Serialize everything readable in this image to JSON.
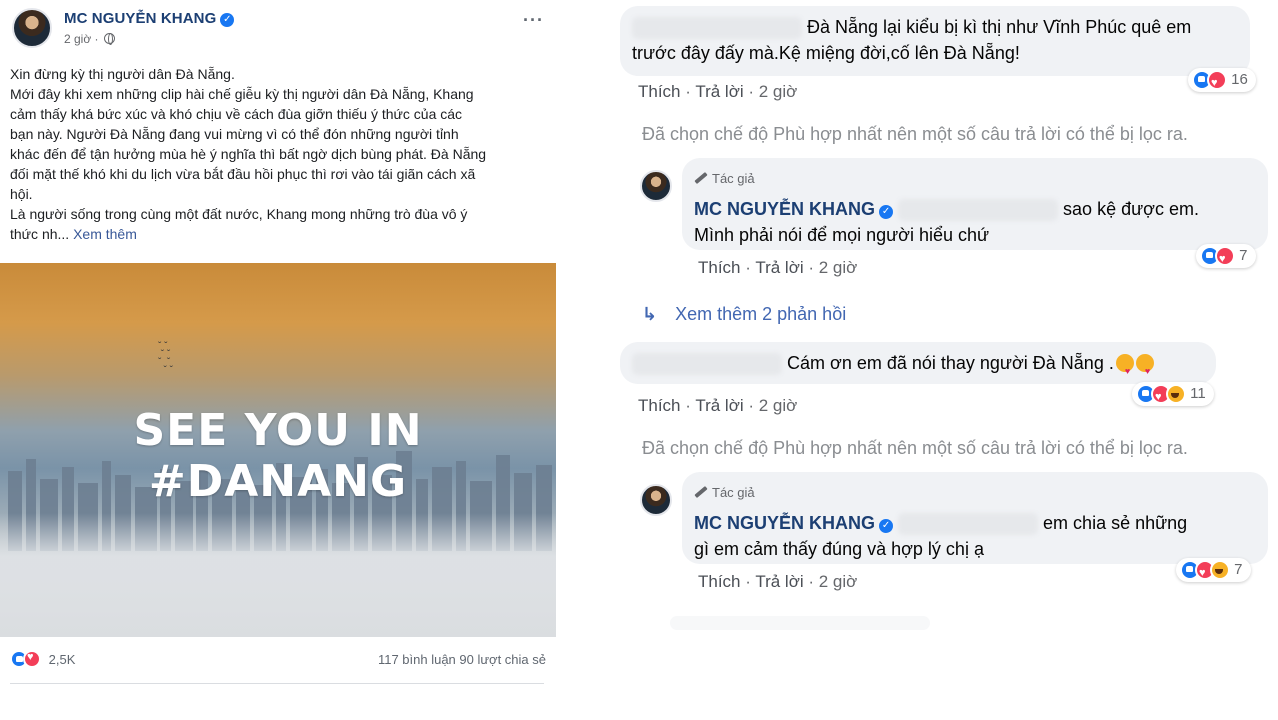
{
  "post": {
    "author": "MC NGUYỄN KHANG",
    "time": "2 giờ ·",
    "more_label": "···",
    "lines": [
      "Xin đừng kỳ thị người dân Đà Nẵng.",
      "Mới đây khi xem những clip hài chế giễu kỳ thị người dân Đà Nẵng, Khang",
      "cảm thấy khá bức xúc và khó chịu về cách đùa giỡn thiếu ý thức của các",
      "bạn này. Người Đà Nẵng đang vui mừng vì có thể đón những người tỉnh",
      "khác đến để tận hưởng mùa hè ý nghĩa thì bất ngờ dịch bùng phát. Đà Nẵng",
      "đối mặt thế khó khi du lịch vừa bắt đầu hồi phục thì rơi vào tái giãn cách xã",
      "hội.",
      "Là người sống trong cùng một đất nước, Khang mong những trò đùa vô ý",
      "thức nh..."
    ],
    "see_more": "Xem thêm",
    "image_headline": "SEE YOU IN #DANANG",
    "reaction_count": "2,5K",
    "stats": "117 bình luận  90 lượt chia sẻ"
  },
  "comments": {
    "c1": {
      "line1": "Đà Nẵng lại kiểu bị kì thị như Vĩnh Phúc quê em",
      "line2": "trước đây đấy mà.Kệ miệng đời,cố lên Đà Nẵng!",
      "like": "Thích",
      "reply": "Trả lời",
      "time": "2 giờ",
      "reactions": "16"
    },
    "filter_note": "Đã chọn chế độ Phù hợp nhất nên một số câu trả lời có thể bị lọc ra.",
    "r1": {
      "tag": "Tác giả",
      "name": "MC NGUYỄN KHANG",
      "line1": "sao kệ được em.",
      "line2": "Mình phải nói để mọi người hiểu chứ",
      "like": "Thích",
      "reply": "Trả lời",
      "time": "2 giờ",
      "reactions": "7"
    },
    "view_more_replies": "Xem thêm 2 phản hồi",
    "c2": {
      "line1": "Cám ơn em đã nói thay người Đà Nẵng .",
      "like": "Thích",
      "reply": "Trả lời",
      "time": "2 giờ",
      "reactions": "11"
    },
    "filter_note_2": "Đã chọn chế độ Phù hợp nhất nên một số câu trả lời có thể bị lọc ra.",
    "r2": {
      "tag": "Tác giả",
      "name": "MC NGUYỄN KHANG",
      "line1": "em chia sẻ những",
      "line2": "gì em cảm thấy đúng và hợp lý chị ạ",
      "like": "Thích",
      "reply": "Trả lời",
      "time": "2 giờ",
      "reactions": "7"
    }
  },
  "icons": {
    "verified": "verified-badge-icon",
    "globe": "globe-icon",
    "like": "like-reaction-icon",
    "love": "love-reaction-icon",
    "haha": "haha-reaction-icon",
    "reply_arrow": "reply-arrow-icon",
    "author_pen": "pen-icon"
  },
  "colors": {
    "name_blue": "#1c3f73",
    "link_blue": "#385898",
    "bubble_grey": "#f0f2f5",
    "like_blue": "#1877f2",
    "love_red": "#f33e58"
  }
}
